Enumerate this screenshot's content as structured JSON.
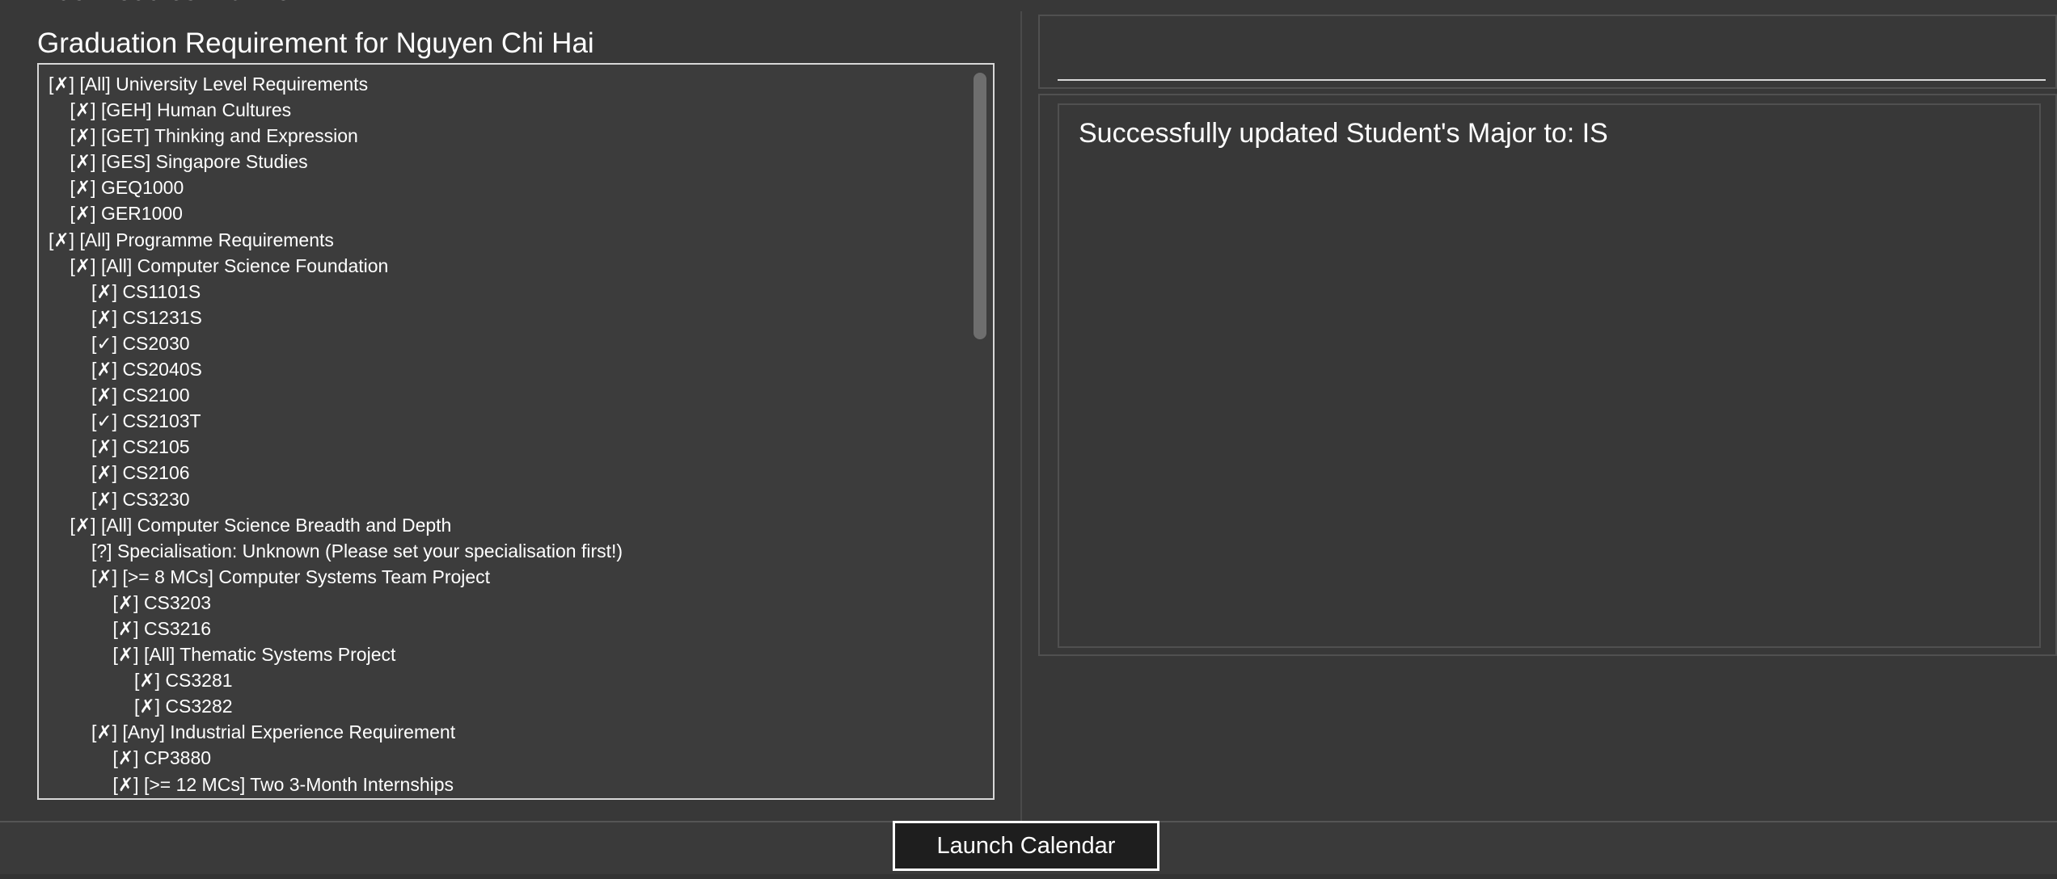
{
  "window": {
    "top_cut_text": "Nus Modules Planner"
  },
  "requirements_panel": {
    "title": "Graduation Requirement for Nguyen Chi Hai",
    "items": [
      {
        "indent": 0,
        "text": "[✗] [All] University Level Requirements"
      },
      {
        "indent": 1,
        "text": "[✗] [GEH] Human Cultures"
      },
      {
        "indent": 1,
        "text": "[✗] [GET] Thinking and Expression"
      },
      {
        "indent": 1,
        "text": "[✗] [GES] Singapore Studies"
      },
      {
        "indent": 1,
        "text": "[✗] GEQ1000"
      },
      {
        "indent": 1,
        "text": "[✗] GER1000"
      },
      {
        "indent": 0,
        "text": "[✗] [All] Programme Requirements"
      },
      {
        "indent": 1,
        "text": "[✗] [All] Computer Science Foundation"
      },
      {
        "indent": 2,
        "text": "[✗] CS1101S"
      },
      {
        "indent": 2,
        "text": "[✗] CS1231S"
      },
      {
        "indent": 2,
        "text": "[✓] CS2030"
      },
      {
        "indent": 2,
        "text": "[✗] CS2040S"
      },
      {
        "indent": 2,
        "text": "[✗] CS2100"
      },
      {
        "indent": 2,
        "text": "[✓] CS2103T"
      },
      {
        "indent": 2,
        "text": "[✗] CS2105"
      },
      {
        "indent": 2,
        "text": "[✗] CS2106"
      },
      {
        "indent": 2,
        "text": "[✗] CS3230"
      },
      {
        "indent": 1,
        "text": "[✗] [All] Computer Science Breadth and Depth"
      },
      {
        "indent": 2,
        "text": "[?] Specialisation: Unknown (Please set your specialisation first!)"
      },
      {
        "indent": 2,
        "text": "[✗] [>= 8 MCs] Computer Systems Team Project"
      },
      {
        "indent": 3,
        "text": "[✗] CS3203"
      },
      {
        "indent": 3,
        "text": "[✗] CS3216"
      },
      {
        "indent": 3,
        "text": "[✗] [All] Thematic Systems Project"
      },
      {
        "indent": 4,
        "text": "[✗] CS3281"
      },
      {
        "indent": 4,
        "text": "[✗] CS3282"
      },
      {
        "indent": 2,
        "text": "[✗] [Any] Industrial Experience Requirement"
      },
      {
        "indent": 3,
        "text": "[✗] CP3880"
      },
      {
        "indent": 3,
        "text": "[✗] [>= 12 MCs] Two 3-Month Internships"
      }
    ],
    "scroll_fraction_visible": 0.37
  },
  "command_box": {
    "value": "",
    "placeholder": ""
  },
  "result_display": {
    "text": "Successfully updated Student's Major to: IS"
  },
  "footer": {
    "launch_button_label": "Launch Calendar"
  },
  "colors": {
    "background": "#3c3c3c",
    "panel": "#383838",
    "border": "#d8d8d8",
    "button_bg": "#1e1e1e",
    "text": "#ffffff"
  }
}
